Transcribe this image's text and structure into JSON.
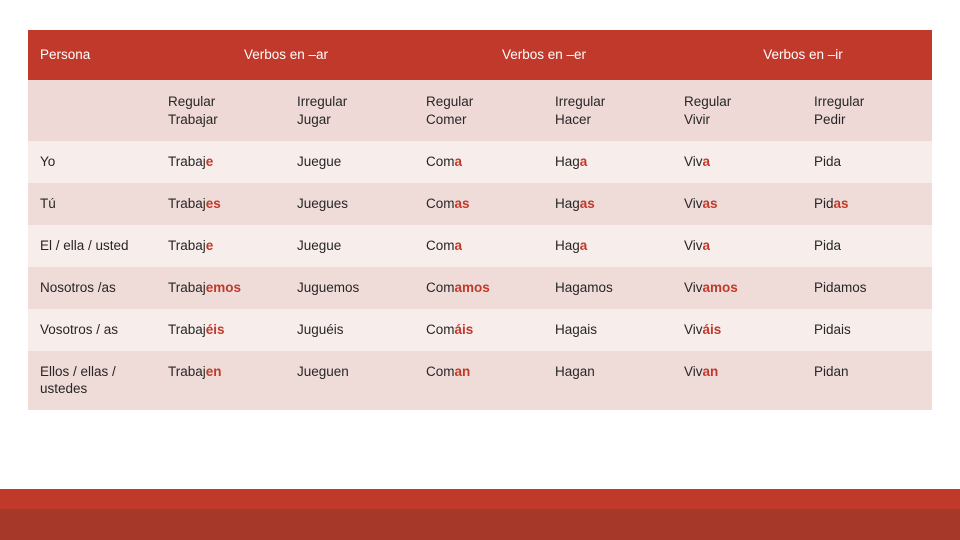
{
  "slide": {
    "title_row": {
      "persona": "Persona",
      "groups": [
        "Verbos en –ar",
        "Verbos en –er",
        "Verbos en –ir"
      ]
    },
    "subheader": {
      "blank": "",
      "columns": [
        {
          "type": "Regular",
          "verb": "Trabajar"
        },
        {
          "type": "Irregular",
          "verb": "Jugar"
        },
        {
          "type": "Regular",
          "verb": "Comer"
        },
        {
          "type": "Irregular",
          "verb": "Hacer"
        },
        {
          "type": "Regular",
          "verb": "Vivir"
        },
        {
          "type": "Irregular",
          "verb": "Pedir"
        }
      ]
    },
    "rows": [
      {
        "person": "Yo",
        "cells": [
          {
            "stem": "Trabaj",
            "ending": "e"
          },
          {
            "stem": "Juegue",
            "ending": ""
          },
          {
            "stem": "Com",
            "ending": "a"
          },
          {
            "stem": "Hag",
            "ending": "a"
          },
          {
            "stem": "Viv",
            "ending": "a"
          },
          {
            "stem": "Pida",
            "ending": ""
          }
        ]
      },
      {
        "person": "Tú",
        "cells": [
          {
            "stem": "Trabaj",
            "ending": "es"
          },
          {
            "stem": "Juegues",
            "ending": ""
          },
          {
            "stem": "Com",
            "ending": "as"
          },
          {
            "stem": "Hag",
            "ending": "as"
          },
          {
            "stem": "Viv",
            "ending": "as"
          },
          {
            "stem": "Pid",
            "ending": "as"
          }
        ]
      },
      {
        "person": "El / ella / usted",
        "cells": [
          {
            "stem": "Trabaj",
            "ending": "e"
          },
          {
            "stem": "Juegue",
            "ending": ""
          },
          {
            "stem": "Com",
            "ending": "a"
          },
          {
            "stem": "Hag",
            "ending": "a"
          },
          {
            "stem": "Viv",
            "ending": "a"
          },
          {
            "stem": "Pida",
            "ending": ""
          }
        ]
      },
      {
        "person": "Nosotros /as",
        "cells": [
          {
            "stem": "Trabaj",
            "ending": "emos"
          },
          {
            "stem": "Juguemos",
            "ending": ""
          },
          {
            "stem": "Com",
            "ending": "amos"
          },
          {
            "stem": "Hagamos",
            "ending": ""
          },
          {
            "stem": "Viv",
            "ending": "amos"
          },
          {
            "stem": "Pidamos",
            "ending": ""
          }
        ]
      },
      {
        "person": "Vosotros / as",
        "cells": [
          {
            "stem": "Trabaj",
            "ending": "éis"
          },
          {
            "stem": "Juguéis",
            "ending": ""
          },
          {
            "stem": "Com",
            "ending": "áis"
          },
          {
            "stem": "Hagais",
            "ending": ""
          },
          {
            "stem": "Viv",
            "ending": "áis"
          },
          {
            "stem": "Pidais",
            "ending": ""
          }
        ]
      },
      {
        "person": "Ellos / ellas / ustedes",
        "cells": [
          {
            "stem": "Trabaj",
            "ending": "en"
          },
          {
            "stem": "Jueguen",
            "ending": ""
          },
          {
            "stem": "Com",
            "ending": "an"
          },
          {
            "stem": "Hagan",
            "ending": ""
          },
          {
            "stem": "Viv",
            "ending": "an"
          },
          {
            "stem": "Pidan",
            "ending": ""
          }
        ]
      }
    ],
    "colors": {
      "header_red": "#C0392B",
      "subheader_bg": "#EFD9D6",
      "row_light": "#F7EDEB",
      "row_dark": "#EFDCD9",
      "accent_text": "#C0392B",
      "footer_bar": "#A6382A"
    }
  }
}
